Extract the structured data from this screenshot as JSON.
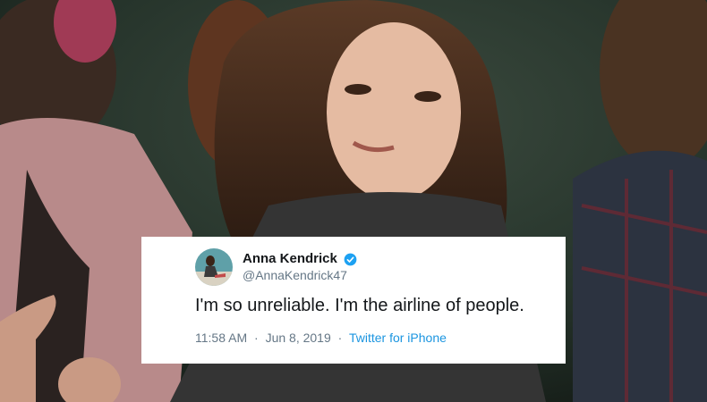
{
  "tweet": {
    "display_name": "Anna Kendrick",
    "handle": "@AnnaKendrick47",
    "text": "I'm so unreliable. I'm the airline of people.",
    "time": "11:58 AM",
    "separator": "·",
    "date": "Jun 8, 2019",
    "source": "Twitter for iPhone",
    "verified": true
  },
  "icons": {
    "verified": "verified-badge-icon",
    "avatar": "profile-avatar"
  },
  "colors": {
    "card_background": "#ffffff",
    "name": "#14171a",
    "secondary_text": "#657786",
    "link": "#1b95e0",
    "verified_badge": "#1da1f2"
  }
}
